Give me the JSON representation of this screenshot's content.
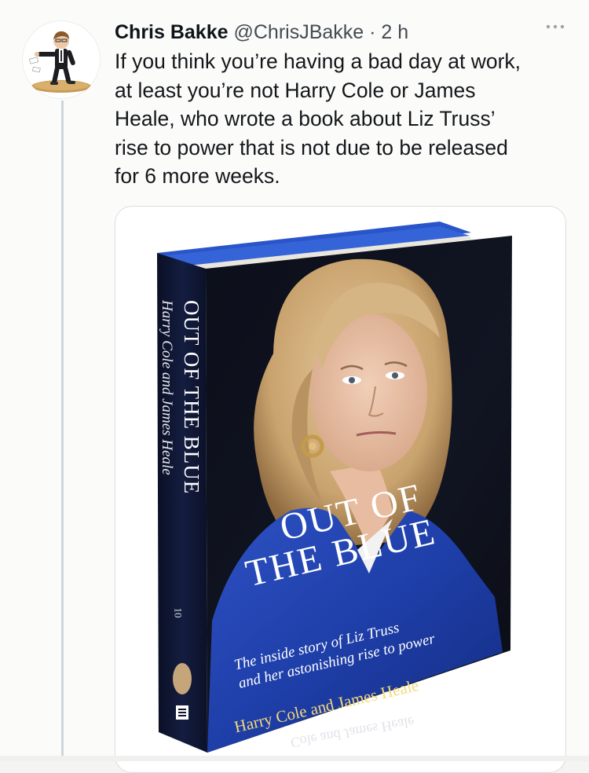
{
  "tweet": {
    "author_name": "Chris Bakke",
    "author_handle": "@ChrisJBakke",
    "separator": "·",
    "timestamp": "2 h",
    "text": "If you think you’re having a bad day at work,\nat least you’re not Harry Cole or James\nHeale, who wrote a book about Liz Truss’\nrise to power that is not due to be released\nfor 6 more weeks."
  },
  "book": {
    "spine_title": "OUT OF THE BLUE",
    "spine_authors": "Harry Cole and James Heale",
    "spine_number": "10",
    "cover_title_line1": "OUT OF",
    "cover_title_line2": "THE BLUE",
    "cover_subtitle_line1": "The inside story of Liz Truss",
    "cover_subtitle_line2": "and her astonishing rise to power",
    "cover_authors": "Harry Cole and James Heale",
    "reflection_text": "Cole and James Heale"
  },
  "icons": {
    "more": "more-horizontal-icon",
    "avatar": "avatar-cartoon-icon",
    "publisher_logo": "publisher-logo-icon"
  },
  "colors": {
    "book_blue": "#1f3fa8",
    "book_dark": "#0e1630",
    "author_gold": "#f4d97a"
  }
}
